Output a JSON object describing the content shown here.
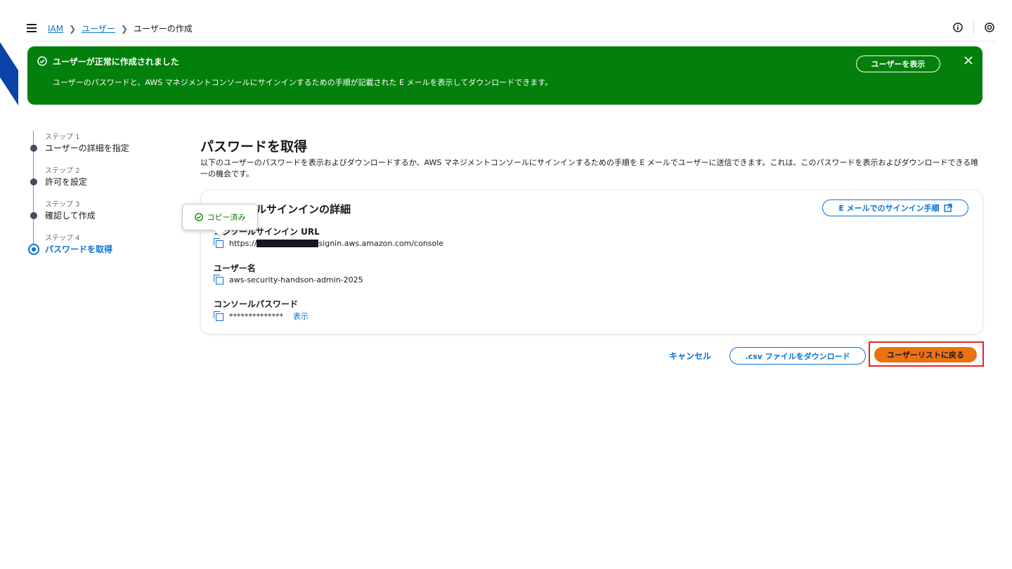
{
  "breadcrumb": {
    "items": [
      "IAM",
      "ユーザー"
    ],
    "current": "ユーザーの作成"
  },
  "icons": {
    "menu": "hamburger-menu-icon",
    "info": "info-icon",
    "settings": "notification-icon",
    "success": "check-circle-icon",
    "close": "close-icon",
    "copy": "copy-icon",
    "external": "external-link-icon"
  },
  "flash": {
    "title": "ユーザーが正常に作成されました",
    "message": "ユーザーのパスワードと、AWS マネジメントコンソールにサインインするための手順が記載された E メールを表示してダウンロードできます。",
    "view_user_button": "ユーザーを表示"
  },
  "steps": [
    {
      "number": "ステップ 1",
      "label": "ユーザーの詳細を指定"
    },
    {
      "number": "ステップ 2",
      "label": "許可を設定"
    },
    {
      "number": "ステップ 3",
      "label": "確認して作成"
    },
    {
      "number": "ステップ 4",
      "label": "パスワードを取得"
    }
  ],
  "page": {
    "title": "パスワードを取得",
    "description": "以下のユーザーのパスワードを表示およびダウンロードするか、AWS マネジメントコンソールにサインインするための手順を E メールでユーザーに送信できます。これは、このパスワードを表示およびダウンロードできる唯一の機会です。"
  },
  "card": {
    "title": "コンソールサインインの詳細",
    "email_button": "E メールでのサインイン手順",
    "url_label": "コンソールサインイン URL",
    "url_prefix": "https://",
    "url_suffix": "signin.aws.amazon.com/console",
    "username_label": "ユーザー名",
    "username": "aws-security-handson-admin-2025",
    "password_label": "コンソールパスワード",
    "password_masked": "**************",
    "show_link": "表示"
  },
  "tooltip": {
    "text": "コピー済み"
  },
  "footer": {
    "cancel": "キャンセル",
    "download_csv": ".csv ファイルをダウンロード",
    "return_button": "ユーザーリストに戻る"
  },
  "colors": {
    "success_bg": "#037f0c",
    "link": "#0972d3",
    "primary": "#ec7211",
    "highlight_border": "#e8231f"
  }
}
